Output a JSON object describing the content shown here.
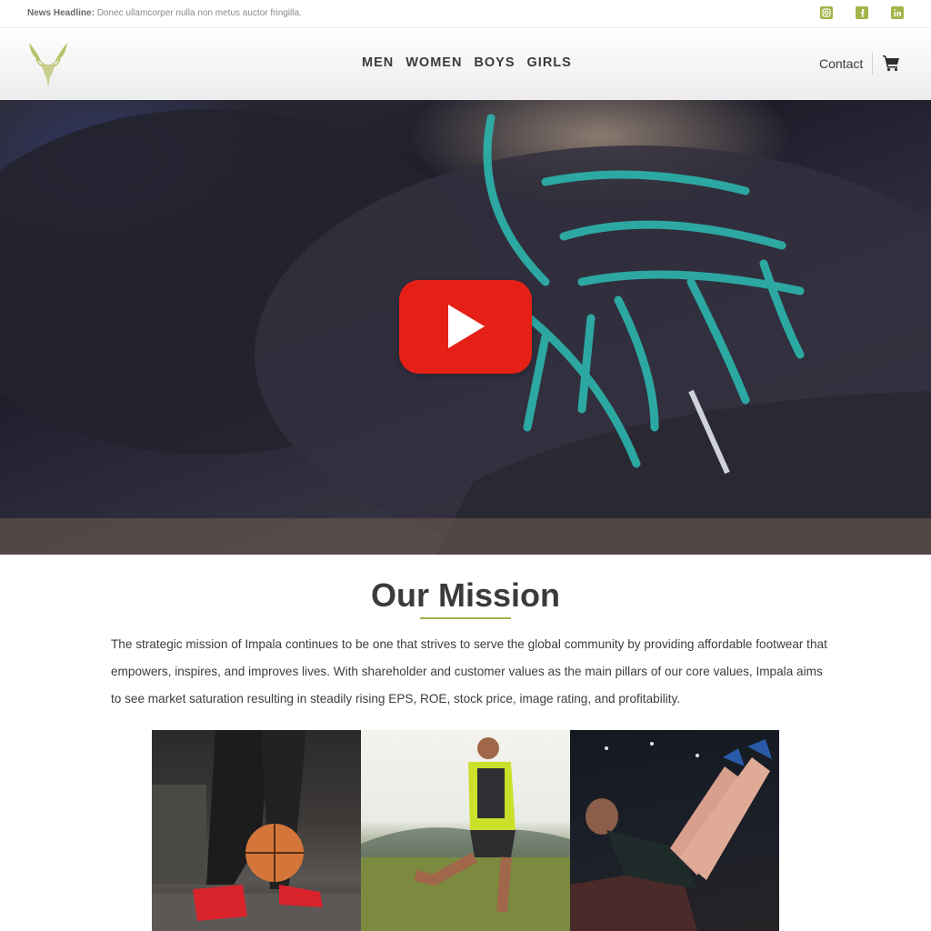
{
  "topbar": {
    "news_label": "News Headline:",
    "news_text": "Donec ullamcorper nulla non metus auctor fringilla.",
    "social": [
      {
        "name": "instagram-icon"
      },
      {
        "name": "facebook-icon"
      },
      {
        "name": "linkedin-icon"
      }
    ]
  },
  "header": {
    "nav": [
      "MEN",
      "WOMEN",
      "BOYS",
      "GIRLS"
    ],
    "contact_label": "Contact"
  },
  "colors": {
    "accent": "#a4b34a",
    "play_button": "#e52117"
  },
  "mission": {
    "title": "Our Mission",
    "body": "The strategic mission of Impala continues to be one that strives to serve the global community by providing affordable footwear that empowers, inspires, and improves lives. With shareholder and customer values as the main pillars of our core values, Impala aims to see market saturation resulting in steadily rising EPS, ROE, stock price, image rating, and profitability."
  }
}
